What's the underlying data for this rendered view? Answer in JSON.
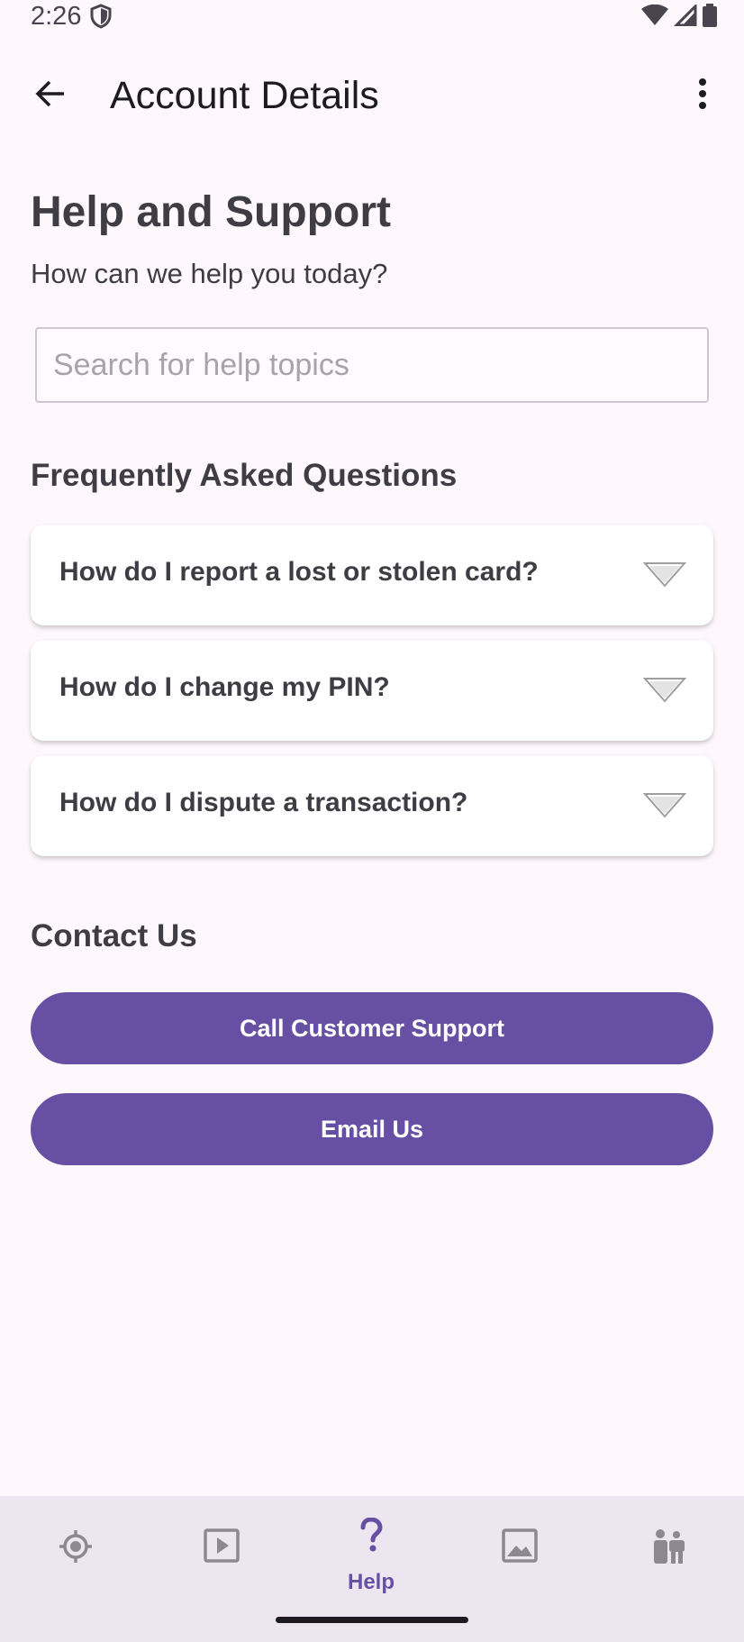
{
  "status_bar": {
    "time": "2:26"
  },
  "app_bar": {
    "title": "Account Details"
  },
  "page": {
    "heading": "Help and Support",
    "subheading": "How can we help you today?"
  },
  "search": {
    "placeholder": "Search for help topics",
    "value": ""
  },
  "faq": {
    "title": "Frequently Asked Questions",
    "items": [
      {
        "question": "How do I report a lost or stolen card?"
      },
      {
        "question": "How do I change my PIN?"
      },
      {
        "question": "How do I dispute a transaction?"
      }
    ]
  },
  "contact": {
    "title": "Contact Us",
    "call_label": "Call Customer Support",
    "email_label": "Email Us"
  },
  "bottom_nav": {
    "items": [
      {
        "icon": "locate-icon",
        "label": ""
      },
      {
        "icon": "play-icon",
        "label": ""
      },
      {
        "icon": "help-icon",
        "label": "Help",
        "selected": true
      },
      {
        "icon": "image-icon",
        "label": ""
      },
      {
        "icon": "family-icon",
        "label": ""
      }
    ]
  },
  "colors": {
    "accent": "#6750a4",
    "background": "#fef7fc",
    "nav_background": "#ece6f0",
    "inactive_icon": "#8c8891"
  }
}
